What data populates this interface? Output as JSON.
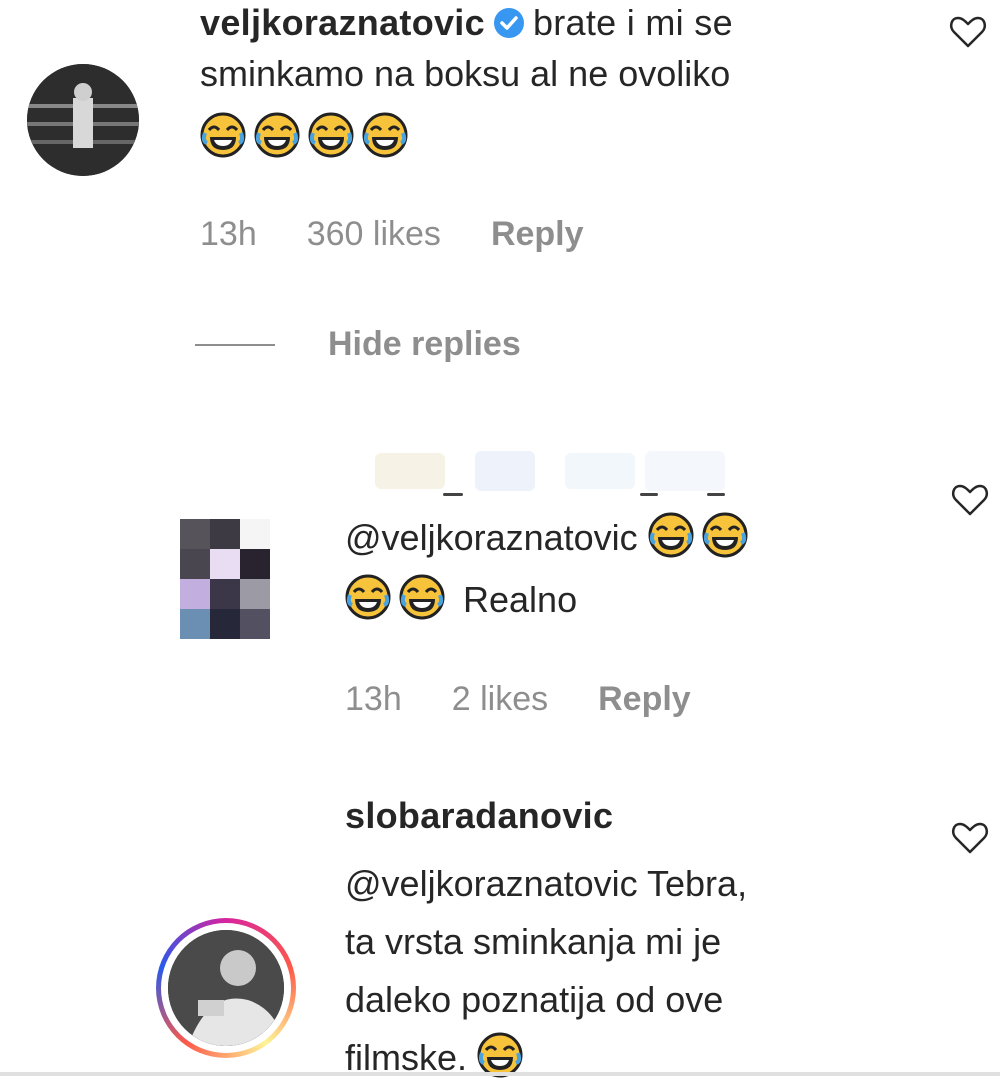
{
  "comments": [
    {
      "username": "veljkoraznatovic",
      "verified": true,
      "text_line1": "brate i mi se",
      "text_line2": "sminkamo na boksu al ne ovoliko",
      "emoji": "face-with-tears-of-joy",
      "emoji_count": 4,
      "time": "13h",
      "likes": "360 likes",
      "reply_label": "Reply"
    }
  ],
  "hide_replies_label": "Hide replies",
  "replies": [
    {
      "username": "",
      "username_obscured": true,
      "mention": "@veljkoraznatovic",
      "text_tail": "Realno",
      "time": "13h",
      "likes": "2 likes",
      "reply_label": "Reply"
    },
    {
      "username": "slobaradanovic",
      "text_line1": "@veljkoraznatovic Tebra,",
      "text_line2": "ta vrsta sminkanja mi je",
      "text_line3": "daleko poznatija od ove",
      "text_line4": "filmske."
    }
  ],
  "colors": {
    "text": "#262626",
    "meta": "#8e8e8e",
    "verified_blue": "#3897f0",
    "emoji_yellow": "#f7c33b"
  },
  "icons": [
    "heart-icon",
    "verified-badge-icon",
    "face-with-tears-of-joy-icon"
  ]
}
